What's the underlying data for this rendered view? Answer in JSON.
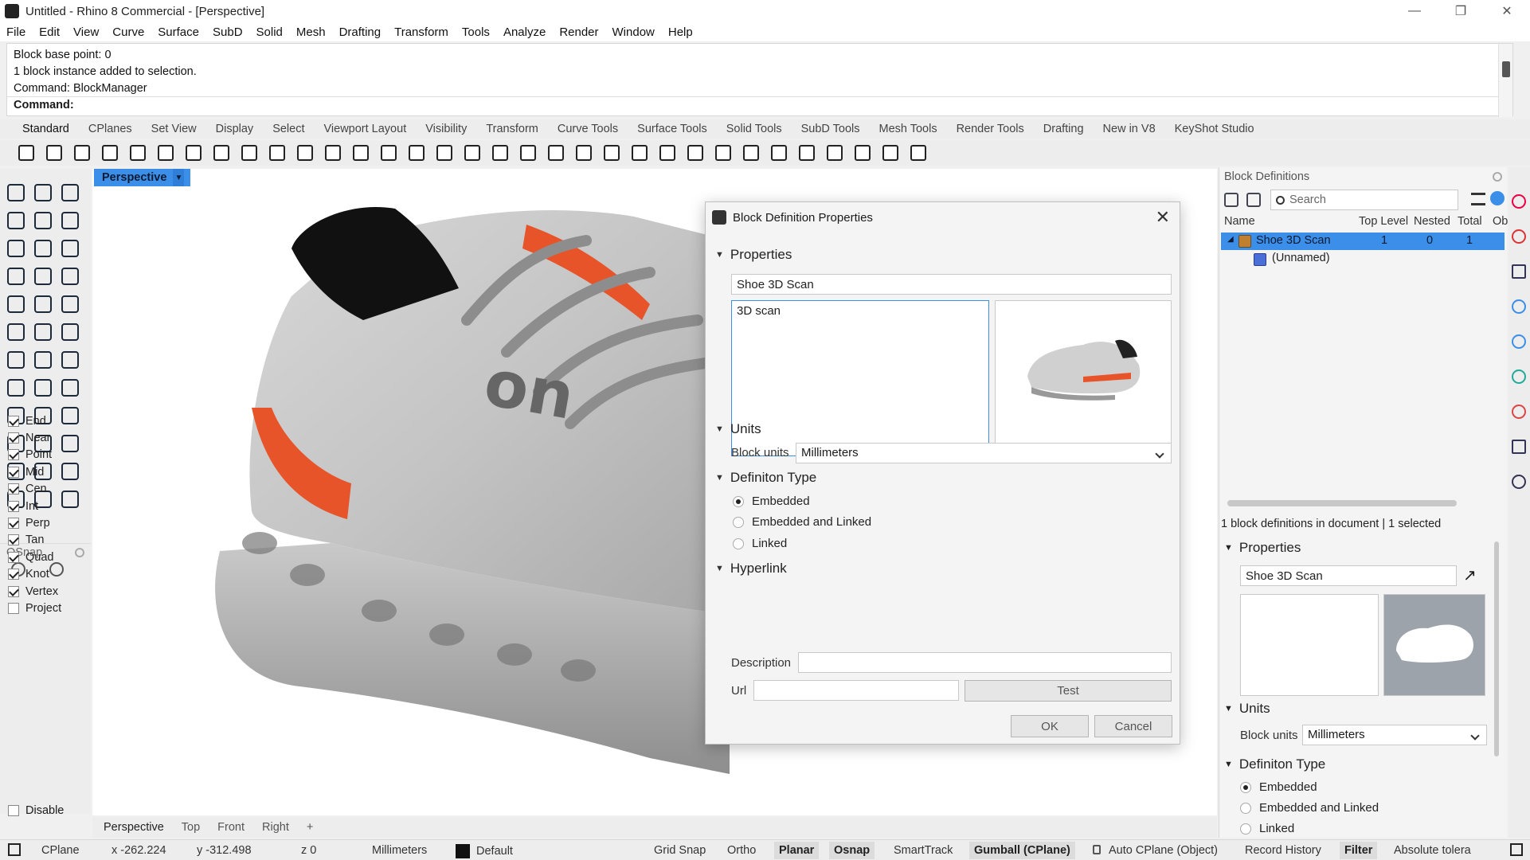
{
  "window": {
    "title": "Untitled - Rhino 8 Commercial - [Perspective]",
    "controls": [
      "—",
      "❐",
      "✕"
    ]
  },
  "menu": [
    "File",
    "Edit",
    "View",
    "Curve",
    "Surface",
    "SubD",
    "Solid",
    "Mesh",
    "Drafting",
    "Transform",
    "Tools",
    "Analyze",
    "Render",
    "Window",
    "Help"
  ],
  "command": {
    "history": [
      "Block base point: 0",
      "1 block instance added to selection.",
      "Command: BlockManager"
    ],
    "prompt": "Command:"
  },
  "toolbar_tabs": [
    "Standard",
    "CPlanes",
    "Set View",
    "Display",
    "Select",
    "Viewport Layout",
    "Visibility",
    "Transform",
    "Curve Tools",
    "Surface Tools",
    "Solid Tools",
    "SubD Tools",
    "Mesh Tools",
    "Render Tools",
    "Drafting",
    "New in V8",
    "KeyShot Studio"
  ],
  "toolbar_icons": [
    "new-icon",
    "open-icon",
    "save-icon",
    "print-icon",
    "export-icon",
    "cut-icon",
    "copy-icon",
    "paste-icon",
    "undo-icon",
    "pan-icon",
    "rotate-icon",
    "zoom-icon",
    "zoom-window-icon",
    "zoom-extents-icon",
    "zoom-selected-icon",
    "rotate-view-icon",
    "viewport-layout-icon",
    "car-icon",
    "grid-icon",
    "cplane-icon",
    "snap-icon",
    "light-icon",
    "lock-icon",
    "material-icon",
    "color-wheel-icon",
    "shade-icon",
    "render-sphere-icon",
    "sphere-icon",
    "flag-icon",
    "settings-icon",
    "tree-icon",
    "globe-icon",
    "help-icon"
  ],
  "viewport": {
    "active_name": "Perspective",
    "tabs": [
      "Perspective",
      "Top",
      "Front",
      "Right",
      "+"
    ]
  },
  "osnap": {
    "title": "OSnap",
    "items": [
      {
        "label": "End",
        "checked": true
      },
      {
        "label": "Near",
        "checked": true
      },
      {
        "label": "Point",
        "checked": true
      },
      {
        "label": "Mid",
        "checked": true
      },
      {
        "label": "Cen",
        "checked": true
      },
      {
        "label": "Int",
        "checked": true
      },
      {
        "label": "Perp",
        "checked": true
      },
      {
        "label": "Tan",
        "checked": true
      },
      {
        "label": "Quad",
        "checked": true
      },
      {
        "label": "Knot",
        "checked": true
      },
      {
        "label": "Vertex",
        "checked": true
      },
      {
        "label": "Project",
        "checked": false
      }
    ],
    "disable": "Disable"
  },
  "dialog": {
    "title": "Block Definition Properties",
    "sections": {
      "properties": "Properties",
      "units": "Units",
      "definition_type": "Definiton Type",
      "hyperlink": "Hyperlink"
    },
    "name_value": "Shoe 3D Scan",
    "description_value": "3D scan",
    "block_units_label": "Block units",
    "block_units_value": "Millimeters",
    "definition_options": [
      {
        "label": "Embedded",
        "selected": true
      },
      {
        "label": "Embedded and Linked",
        "selected": false
      },
      {
        "label": "Linked",
        "selected": false
      }
    ],
    "hyperlink_description_label": "Description",
    "hyperlink_url_label": "Url",
    "test_label": "Test",
    "ok_label": "OK",
    "cancel_label": "Cancel"
  },
  "block_panel": {
    "title": "Block Definitions",
    "search_placeholder": "Search",
    "columns": [
      "Name",
      "Top Level",
      "Nested",
      "Total",
      "Ob"
    ],
    "rows": [
      {
        "name": "Shoe 3D Scan",
        "top_level": "1",
        "nested": "0",
        "total": "1"
      },
      {
        "name": "(Unnamed)",
        "top_level": "",
        "nested": "",
        "total": ""
      }
    ],
    "info": "1 block definitions in document | 1 selected",
    "properties_label": "Properties",
    "name_value": "Shoe 3D Scan",
    "units_label": "Units",
    "block_units_label": "Block units",
    "block_units_value": "Millimeters",
    "definition_type_label": "Definiton Type",
    "definition_options": [
      "Embedded",
      "Embedded and Linked",
      "Linked"
    ]
  },
  "status": {
    "cplane": "CPlane",
    "x": "x -262.224",
    "y": "y -312.498",
    "z": "z 0",
    "units": "Millimeters",
    "layer": "Default",
    "grid_snap": "Grid Snap",
    "ortho": "Ortho",
    "planar": "Planar",
    "osnap": "Osnap",
    "smarttrack": "SmartTrack",
    "gumball": "Gumball (CPlane)",
    "auto_cplane": "Auto CPlane (Object)",
    "record_history": "Record History",
    "filter": "Filter",
    "tolerance": "Absolute tolera"
  },
  "colors": {
    "accent": "#3c8fe8",
    "shoe_orange": "#e8542a"
  }
}
